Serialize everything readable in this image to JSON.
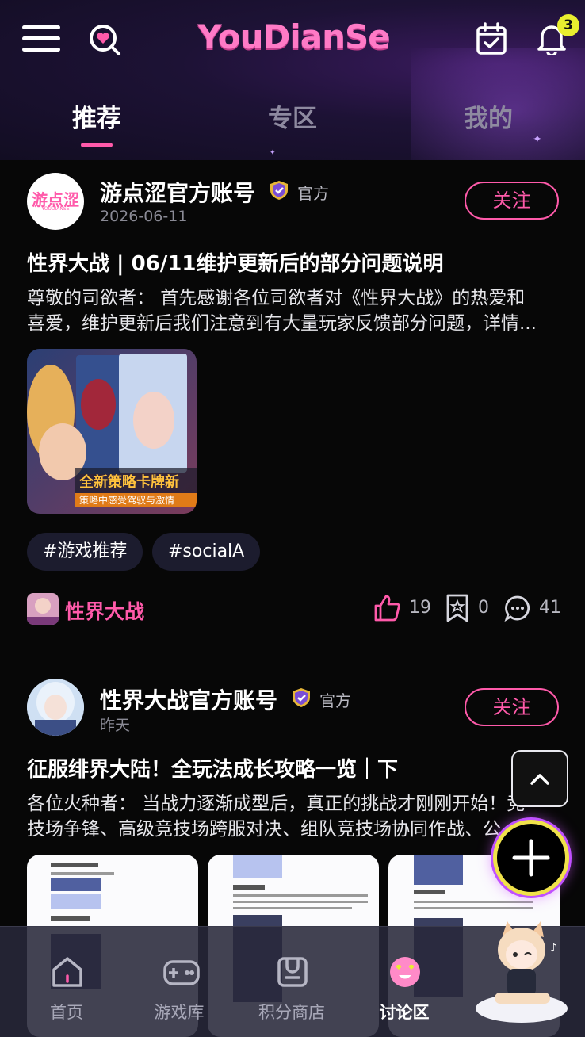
{
  "header": {
    "logo": "YouDianSe",
    "notification_count": "3",
    "tabs": [
      {
        "label": "推荐",
        "active": true
      },
      {
        "label": "专区",
        "active": false
      },
      {
        "label": "我的",
        "active": false
      }
    ]
  },
  "posts": [
    {
      "author": "游点涩官方账号",
      "official_label": "官方",
      "date": "2026-06-11",
      "follow_label": "关注",
      "avatar_text": "游点涩",
      "avatar_subtext": "YOUDIANSE",
      "title": "性界大战 | 06/11维护更新后的部分问题说明",
      "body_lines": [
        "尊敬的司欲者： 首先感谢各位司欲者对《性界大战》的热爱和",
        "喜爱，维护更新后我们注意到有大量玩家反馈部分问题，详情..."
      ],
      "image_caption": "全新策略卡牌新",
      "image_subcaption": "策略中感受驾驭与激情",
      "tags": [
        "#游戏推荐",
        "#socialA"
      ],
      "game_name": "性界大战",
      "likes": "19",
      "bookmarks": "0",
      "comments": "41"
    },
    {
      "author": "性界大战官方账号",
      "official_label": "官方",
      "date": "昨天",
      "follow_label": "关注",
      "title": "征服绯界大陆！全玩法成长攻略一览｜下",
      "body_lines": [
        "各位火种者： 当战力逐渐成型后，真正的挑战才刚刚开始！竞",
        "技场争锋、高级竞技场跨服对决、组队竞技场协同作战、公"
      ]
    }
  ],
  "bottom_nav": [
    {
      "label": "首页",
      "icon": "home-icon",
      "active": false
    },
    {
      "label": "游戏库",
      "icon": "gamepad-icon",
      "active": false
    },
    {
      "label": "积分商店",
      "icon": "shop-icon",
      "active": false
    },
    {
      "label": "讨论区",
      "icon": "heart-eyes-icon",
      "active": true
    }
  ],
  "colors": {
    "accent": "#ff5aaa",
    "badge": "#e9ef2f",
    "fab_ring": "#f0e24a"
  }
}
